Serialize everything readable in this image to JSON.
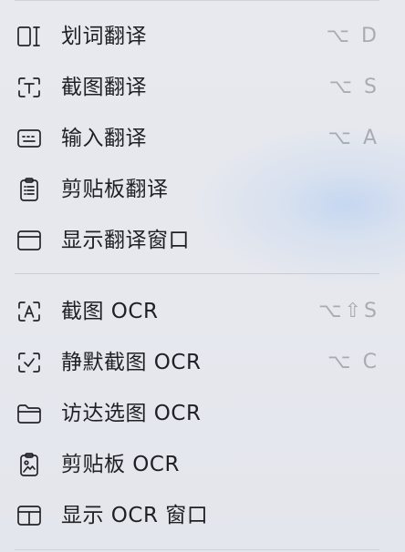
{
  "translate_section": [
    {
      "label": "划词翻译",
      "shortcut": "⌥ D",
      "icon": "selection-translate-icon"
    },
    {
      "label": "截图翻译",
      "shortcut": "⌥ S",
      "icon": "screenshot-translate-icon"
    },
    {
      "label": "输入翻译",
      "shortcut": "⌥ A",
      "icon": "input-translate-icon"
    },
    {
      "label": "剪贴板翻译",
      "shortcut": "",
      "icon": "clipboard-translate-icon"
    },
    {
      "label": "显示翻译窗口",
      "shortcut": "",
      "icon": "window-icon"
    }
  ],
  "ocr_section": [
    {
      "label": "截图 OCR",
      "shortcut": "⌥⇧S",
      "icon": "screenshot-ocr-icon"
    },
    {
      "label": "静默截图 OCR",
      "shortcut": "⌥ C",
      "icon": "silent-screenshot-ocr-icon"
    },
    {
      "label": "访达选图 OCR",
      "shortcut": "",
      "icon": "folder-icon"
    },
    {
      "label": "剪贴板 OCR",
      "shortcut": "",
      "icon": "clipboard-image-icon"
    },
    {
      "label": "显示 OCR 窗口",
      "shortcut": "",
      "icon": "ocr-window-icon"
    }
  ],
  "colors": {
    "text": "#1f2024",
    "shortcut": "#a8abb2",
    "divider": "#c9ccd2"
  }
}
